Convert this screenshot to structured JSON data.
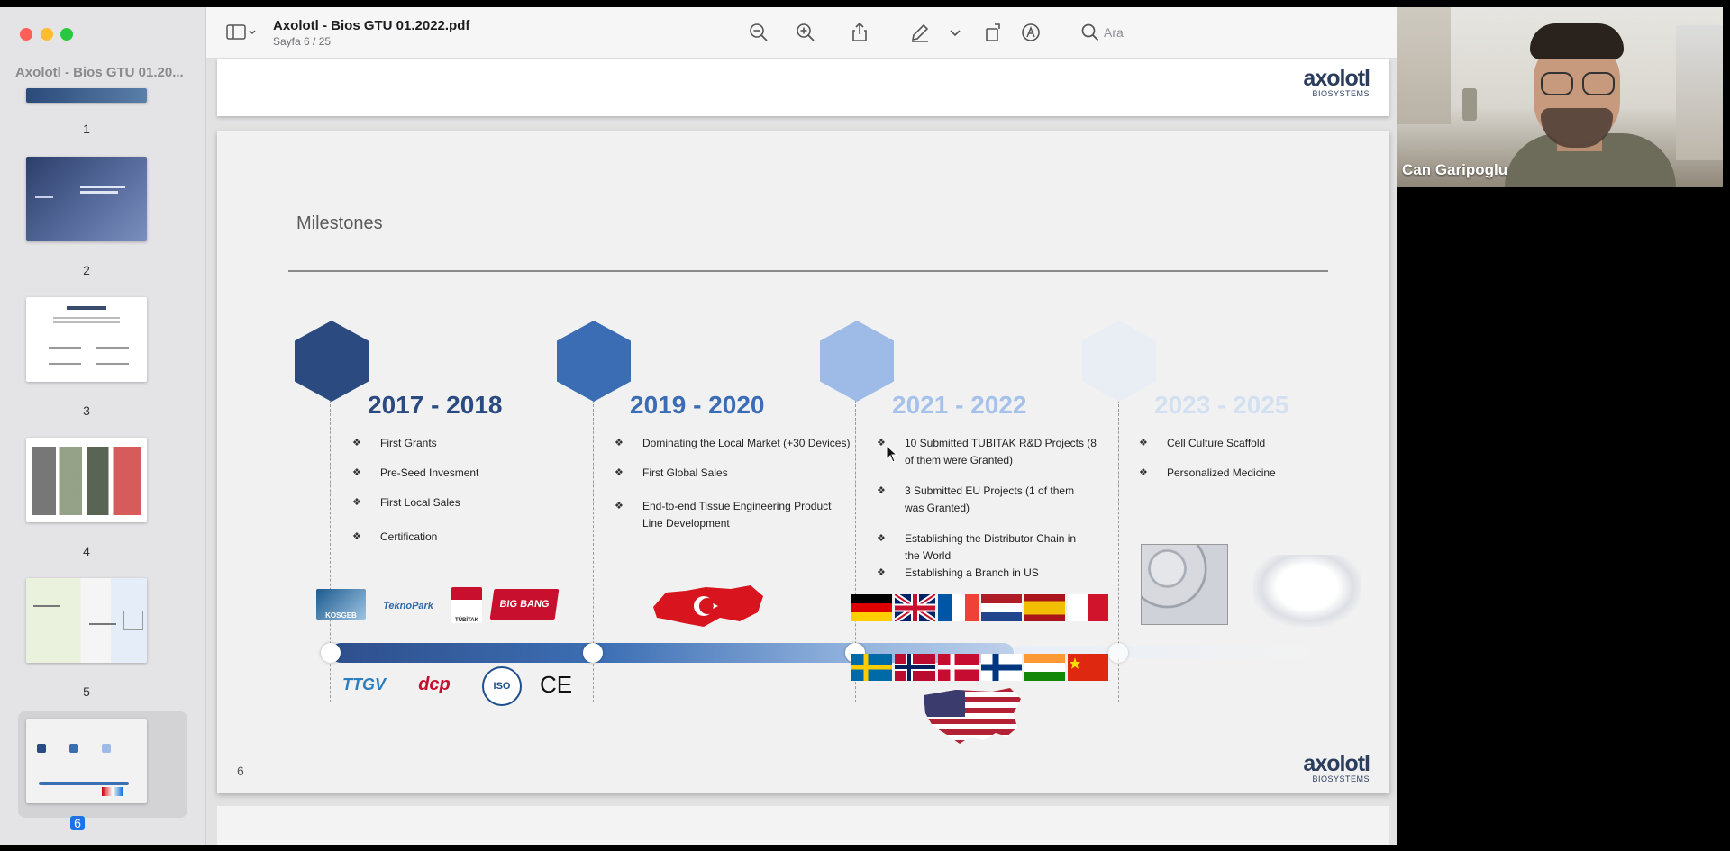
{
  "sidebar": {
    "doc_title": "Axolotl - Bios GTU 01.20...",
    "pages": [
      "1",
      "2",
      "3",
      "4",
      "5",
      "6"
    ],
    "selected_page": 6
  },
  "toolbar": {
    "title": "Axolotl - Bios GTU 01.2022.pdf",
    "page_indicator": "Sayfa 6 / 25",
    "search_placeholder": "Ara",
    "icons": [
      "sidebar-toggle-icon",
      "zoom-out-icon",
      "zoom-in-icon",
      "share-icon",
      "markup-pen-icon",
      "rotate-icon",
      "annotate-icon",
      "search-icon"
    ]
  },
  "document": {
    "logo_word": "axolotl",
    "logo_sub": "BIOSYSTEMS",
    "slide": {
      "title": "Milestones",
      "page_number": "6",
      "periods": [
        {
          "label": "2017 - 2018",
          "color": "#2b4a80",
          "items": [
            "First Grants",
            "Pre-Seed Invesment",
            "First Local Sales",
            "Certification"
          ]
        },
        {
          "label": "2019 - 2020",
          "color": "#3a6db3",
          "items": [
            "Dominating the Local Market (+30 Devices)",
            "First Global Sales",
            "End-to-end Tissue Engineering Product Line Development"
          ]
        },
        {
          "label": "2021 - 2022",
          "color": "#9dbbe6",
          "items": [
            "10 Submitted TUBITAK R&D Projects (8 of them were Granted)",
            "3 Submitted EU Projects (1 of them was Granted)",
            "Establishing the Distributor Chain in the World",
            "Establishing a Branch in US"
          ]
        },
        {
          "label": "2023 - 2025",
          "color": "#d6e2f3",
          "items": [
            "Cell Culture Scaffold",
            "Personalized Medicine"
          ]
        }
      ],
      "partner_logos_top": [
        "KOSGEB",
        "TeknoPark",
        "TÜBİTAK",
        "BIG BANG"
      ],
      "partner_logos_bottom": [
        "TTGV",
        "dcp",
        "ISO",
        "CE"
      ]
    }
  },
  "video": {
    "participant_name": "Can Garipoglu"
  }
}
